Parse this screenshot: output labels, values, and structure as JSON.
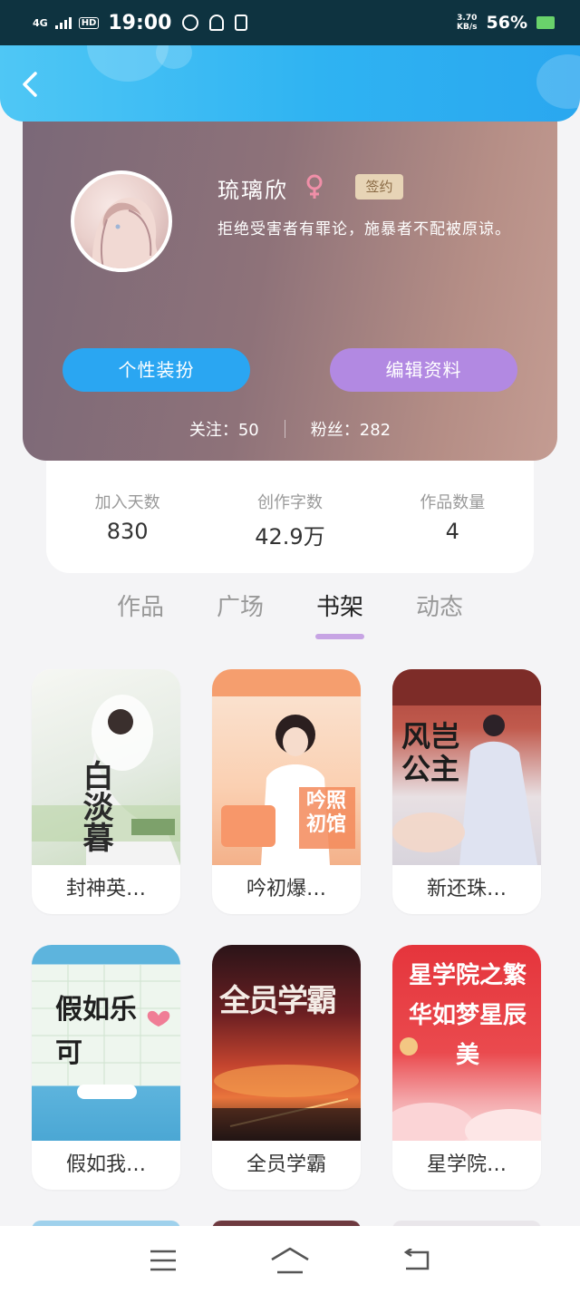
{
  "status_bar": {
    "network": "4G",
    "hd": "HD",
    "time": "19:00",
    "speed_value": "3.70",
    "speed_unit": "KB/s",
    "battery": "56%"
  },
  "profile": {
    "name": "琉璃欣",
    "gender_icon": "female-icon",
    "badge": "签约",
    "bio": "拒绝受害者有罪论，施暴者不配被原谅。",
    "dress_button": "个性装扮",
    "edit_button": "编辑资料",
    "following": "关注：50",
    "followers": "粉丝：282"
  },
  "stats": [
    {
      "label": "加入天数",
      "value": "830"
    },
    {
      "label": "创作字数",
      "value": "42.9万"
    },
    {
      "label": "作品数量",
      "value": "4"
    }
  ],
  "tabs": [
    {
      "label": "作品",
      "active": false
    },
    {
      "label": "广场",
      "active": false
    },
    {
      "label": "书架",
      "active": true
    },
    {
      "label": "动态",
      "active": false
    }
  ],
  "books": [
    {
      "title": "封神英…",
      "cover_text": "白淡暮",
      "colors": [
        "#eef2ee",
        "#c9d8c4"
      ]
    },
    {
      "title": "吟初爆…",
      "cover_text": "吟照初馆",
      "colors": [
        "#fde3cf",
        "#f7b98d"
      ]
    },
    {
      "title": "新还珠…",
      "cover_text": "风岂公主",
      "colors": [
        "#b7554a",
        "#e9e3e6"
      ]
    },
    {
      "title": "假如我…",
      "cover_text": "假如乐可",
      "colors": [
        "#61b7dd",
        "#eef6ee"
      ]
    },
    {
      "title": "全员学霸",
      "cover_text": "全员学霸",
      "colors": [
        "#3c1d22",
        "#b03a2e"
      ]
    },
    {
      "title": "星学院…",
      "cover_text": "星学院之繁华如梦星辰美",
      "colors": [
        "#e43b3f",
        "#f7c8c8"
      ]
    }
  ],
  "colors": {
    "header": "#2fb3f2",
    "dress_button": "#2aa6f2",
    "edit_button": "#b289e2",
    "tab_indicator": "#c7a4e4",
    "badge_bg": "#e7d4b6"
  },
  "nav_icons": [
    "menu-icon",
    "home-icon",
    "back-icon"
  ]
}
